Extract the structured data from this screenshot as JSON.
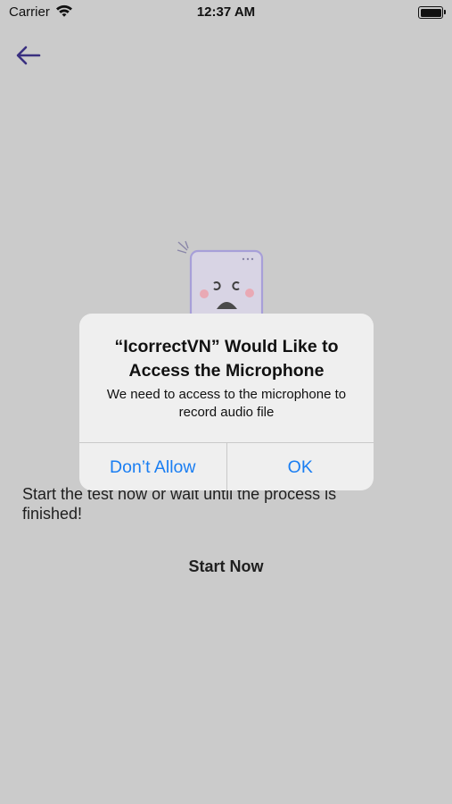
{
  "status_bar": {
    "carrier": "Carrier",
    "time": "12:37 AM"
  },
  "colors": {
    "background": "#cbcbcb",
    "accent": "#3a3080",
    "illustration_stroke": "#a79fd8",
    "alert_button": "#1a7ef2"
  },
  "header": {
    "back_icon": "arrow-left-icon"
  },
  "main": {
    "illustration_icon": "sad-device-icon",
    "message": "Start the test now or wait until the process is finished!",
    "start_button": "Start Now"
  },
  "alert": {
    "title": "“IcorrectVN” Would Like to Access the Microphone",
    "body": "We need to access to the microphone to record audio file",
    "deny_button": "Don’t Allow",
    "allow_button": "OK"
  }
}
